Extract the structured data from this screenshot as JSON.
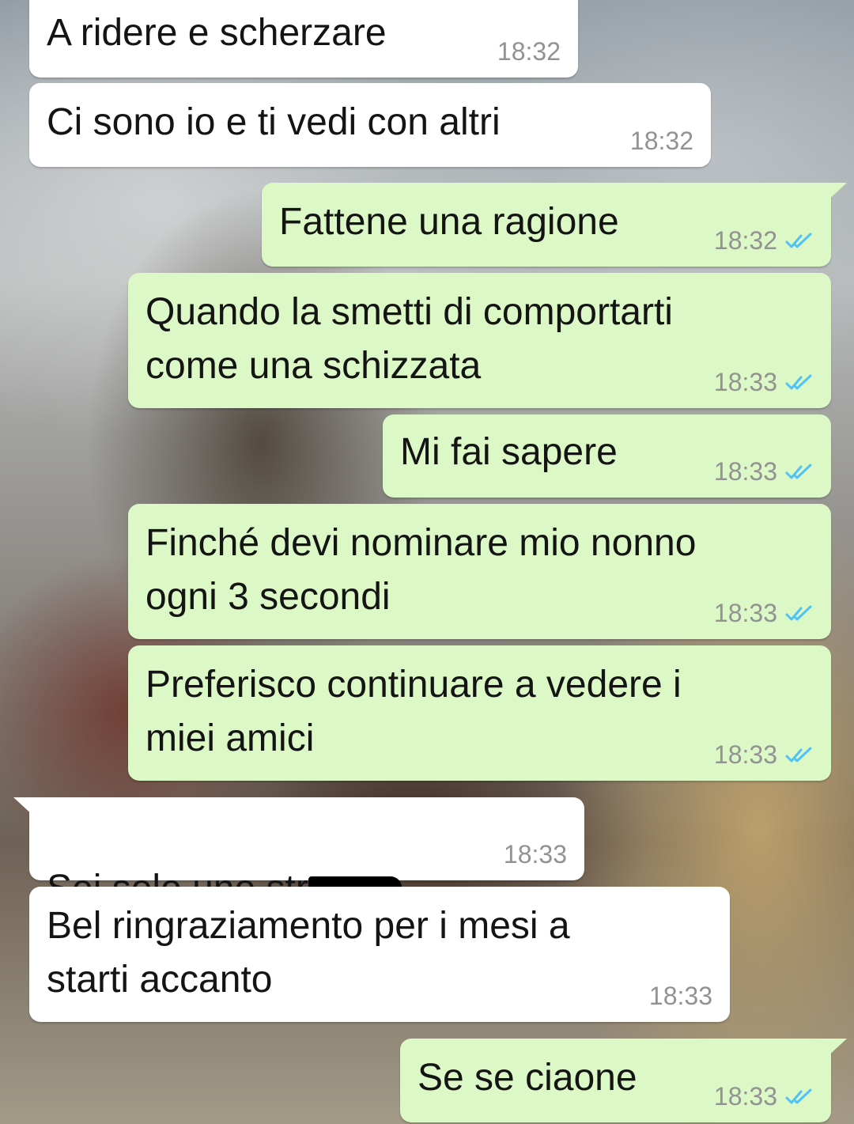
{
  "messages": [
    {
      "id": 1,
      "direction": "incoming",
      "text": "A ridere e scherzare",
      "time": "18:32"
    },
    {
      "id": 2,
      "direction": "incoming",
      "text": "Ci sono io e ti vedi con altri",
      "time": "18:32"
    },
    {
      "id": 3,
      "direction": "outgoing",
      "text": "Fattene una ragione",
      "time": "18:32",
      "status": "read"
    },
    {
      "id": 4,
      "direction": "outgoing",
      "text": "Quando la smetti di comportarti\ncome una schizzata",
      "time": "18:33",
      "status": "read"
    },
    {
      "id": 5,
      "direction": "outgoing",
      "text": "Mi fai sapere",
      "time": "18:33",
      "status": "read"
    },
    {
      "id": 6,
      "direction": "outgoing",
      "text": "Finché devi nominare mio nonno\nogni 3 secondi",
      "time": "18:33",
      "status": "read"
    },
    {
      "id": 7,
      "direction": "outgoing",
      "text": "Preferisco continuare a vedere i\nmiei amici",
      "time": "18:33",
      "status": "read"
    },
    {
      "id": 8,
      "direction": "incoming",
      "text": "Sei solo uno str",
      "time": "18:33",
      "redacted": true
    },
    {
      "id": 9,
      "direction": "incoming",
      "text": "Bel ringraziamento per i mesi a\nstarti accanto",
      "time": "18:33"
    },
    {
      "id": 10,
      "direction": "outgoing",
      "text": "Se se ciaone",
      "time": "18:33",
      "status": "read"
    }
  ],
  "colors": {
    "incoming_bubble": "#ffffff",
    "outgoing_bubble": "#dcf8c6",
    "read_tick": "#4fc3f7",
    "timestamp": "#929292"
  },
  "icons": {
    "read_receipt": "double-check-icon"
  }
}
